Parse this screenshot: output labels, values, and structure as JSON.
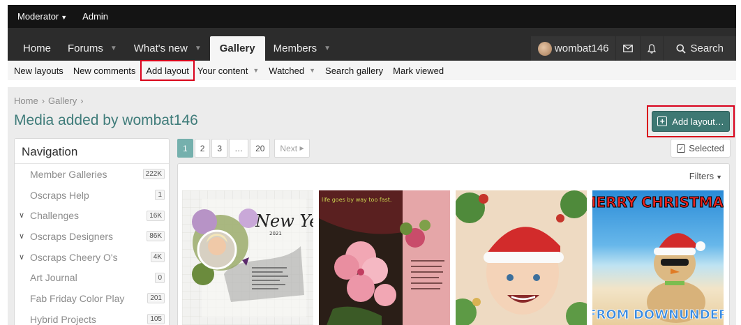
{
  "topbar": {
    "moderator": "Moderator",
    "admin": "Admin"
  },
  "nav": {
    "tabs": [
      {
        "label": "Home",
        "dropdown": false
      },
      {
        "label": "Forums",
        "dropdown": true
      },
      {
        "label": "What's new",
        "dropdown": true
      },
      {
        "label": "Gallery",
        "dropdown": false,
        "active": true
      },
      {
        "label": "Members",
        "dropdown": true
      }
    ],
    "username": "wombat146",
    "search": "Search"
  },
  "subnav": {
    "new_layouts": "New layouts",
    "new_comments": "New comments",
    "add_layout": "Add layout",
    "your_content": "Your content",
    "watched": "Watched",
    "search_gallery": "Search gallery",
    "mark_viewed": "Mark viewed"
  },
  "breadcrumb": {
    "home": "Home",
    "gallery": "Gallery",
    "separator": "›"
  },
  "page_title": "Media added by wombat146",
  "add_layout_button": "Add layout…",
  "sidebar": {
    "title": "Navigation",
    "items": [
      {
        "label": "Member Galleries",
        "count": "222K",
        "expand": false
      },
      {
        "label": "Oscraps Help",
        "count": "1",
        "expand": false
      },
      {
        "label": "Challenges",
        "count": "16K",
        "expand": true
      },
      {
        "label": "Oscraps Designers",
        "count": "86K",
        "expand": true
      },
      {
        "label": "Oscraps Cheery O's",
        "count": "4K",
        "expand": true
      },
      {
        "label": "Art Journal",
        "count": "0",
        "expand": false
      },
      {
        "label": "Fab Friday Color Play",
        "count": "201",
        "expand": false
      },
      {
        "label": "Hybrid Projects",
        "count": "105",
        "expand": false
      }
    ]
  },
  "pagination": {
    "pages": [
      "1",
      "2",
      "3",
      "…",
      "20"
    ],
    "current": "1",
    "next": "Next"
  },
  "selected_button": "Selected",
  "filters_label": "Filters",
  "thumbnails": {
    "t1_text": "New Year",
    "t1_year": "2021",
    "t2_text": "life goes by way too fast.",
    "t4_top": "MERRY CHRISTMAS",
    "t4_bottom": "FROM DOWNUNDER"
  },
  "colors": {
    "accent": "#3e7873",
    "title": "#3f7c7a",
    "highlight": "#d9001b",
    "navbar": "#2c2c2c"
  }
}
